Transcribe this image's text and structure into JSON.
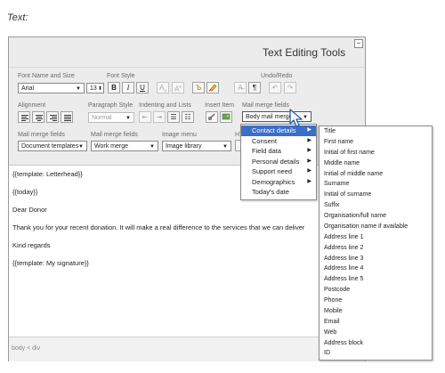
{
  "heading": "Text:",
  "toolbar": {
    "title": "Text Editing Tools",
    "collapse": "−",
    "font": {
      "label": "Font Name and Size",
      "name": "Arial",
      "size": "13"
    },
    "font_style": {
      "label": "Font Style",
      "bold": "B",
      "italic": "I",
      "underline": "U"
    },
    "undo": {
      "label": "Undo/Redo"
    },
    "alignment": {
      "label": "Alignment"
    },
    "paragraph": {
      "label": "Paragraph Style",
      "value": "Normal"
    },
    "indent": {
      "label": "Indenting and Lists"
    },
    "insert": {
      "label": "Insert Item"
    },
    "mail_merge_fields_top": {
      "label": "Mail merge fields",
      "value": "Body mail merge"
    },
    "mail_merge_fields_1": {
      "label": "Mail merge fields",
      "value": "Document templates"
    },
    "mail_merge_fields_2": {
      "label": "Mail merge fields",
      "value": "Work merge"
    },
    "image_menu": {
      "label": "Image menu",
      "value": "Image library"
    },
    "html": {
      "label": "HT"
    }
  },
  "content": [
    "{{template: Letterhead}}",
    "{{today}}",
    "Dear Donor",
    "Thank you for your recent donation. It will make a real difference to the services that we can deliver",
    "Kind regards",
    "{{template: My signature}}"
  ],
  "status_path": "body < div",
  "menu1": [
    {
      "label": "Contact details",
      "sub": true
    },
    {
      "label": "Consent",
      "sub": true
    },
    {
      "label": "Field data",
      "sub": true
    },
    {
      "label": "Personal details",
      "sub": true
    },
    {
      "label": "Support need",
      "sub": true
    },
    {
      "label": "Demographics",
      "sub": true
    },
    {
      "label": "Today's date",
      "sub": false
    }
  ],
  "menu2": [
    "Title",
    "First name",
    "Initial of first name",
    "Middle name",
    "Initial of middle name",
    "Surname",
    "Initial of surname",
    "Suffix",
    "Organisation/full name",
    "Organisation name if available",
    "Address line 1",
    "Address line 2",
    "Address line 3",
    "Address line 4",
    "Address line 5",
    "Postcode",
    "Phone",
    "Mobile",
    "Email",
    "Web",
    "Address block",
    "ID"
  ],
  "colors": {
    "highlight": "#3a6ec9",
    "toolbar_bg": "#ececec"
  },
  "icons": [
    "collapse-icon",
    "subscript-icon",
    "superscript-icon",
    "text-color-icon",
    "highlight-pen-icon",
    "clear-format-icon",
    "paragraph-mark-icon",
    "undo-icon",
    "redo-icon",
    "align-left-icon",
    "align-center-icon",
    "align-right-icon",
    "align-justify-icon",
    "outdent-icon",
    "indent-icon",
    "bullet-list-icon",
    "numbered-list-icon",
    "link-icon",
    "image-icon",
    "submenu-arrow-icon",
    "mouse-pointer-icon"
  ]
}
